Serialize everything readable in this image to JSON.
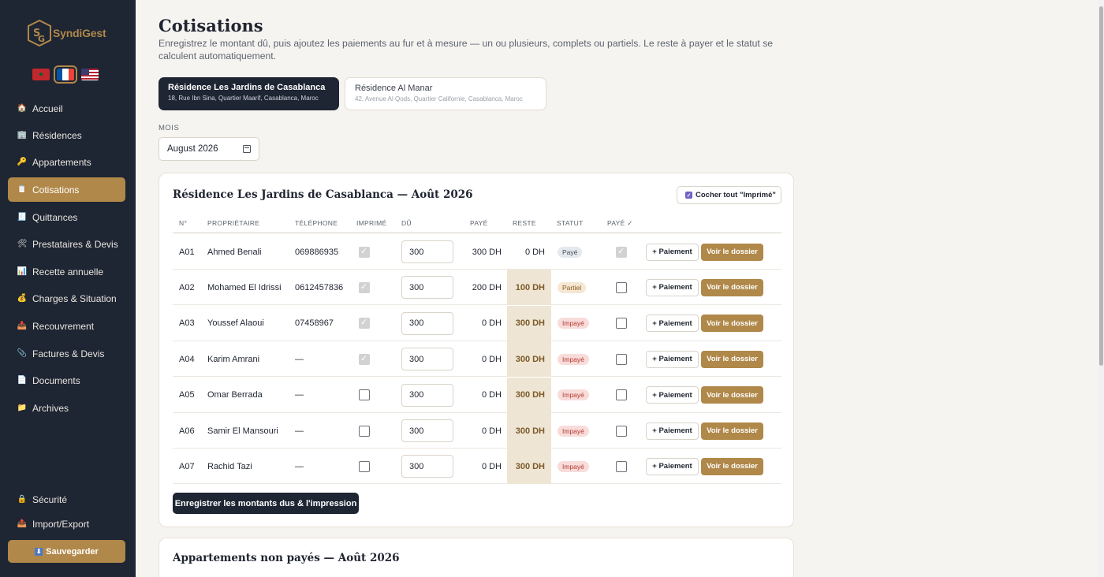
{
  "sidebar": {
    "brand": "SyndiGest",
    "languages": [
      {
        "code": "ar",
        "icon": "morocco-flag-icon"
      },
      {
        "code": "fr",
        "icon": "france-flag-icon",
        "active": true
      },
      {
        "code": "en",
        "icon": "usa-flag-icon"
      }
    ],
    "nav": [
      {
        "label": "Accueil",
        "icon": "home-icon"
      },
      {
        "label": "Résidences",
        "icon": "building-icon"
      },
      {
        "label": "Appartements",
        "icon": "key-icon"
      },
      {
        "label": "Cotisations",
        "icon": "clipboard-icon",
        "active": true
      },
      {
        "label": "Quittances",
        "icon": "receipt-icon"
      },
      {
        "label": "Prestataires & Devis",
        "icon": "tools-icon"
      },
      {
        "label": "Recette annuelle",
        "icon": "chart-icon"
      },
      {
        "label": "Charges & Situation",
        "icon": "money-bag-icon"
      },
      {
        "label": "Recouvrement",
        "icon": "inbox-icon"
      },
      {
        "label": "Factures & Devis",
        "icon": "paperclip-icon"
      },
      {
        "label": "Documents",
        "icon": "document-icon"
      },
      {
        "label": "Archives",
        "icon": "folder-icon"
      }
    ],
    "bottom_nav": [
      {
        "label": "Sécurité",
        "icon": "lock-icon"
      },
      {
        "label": "Import/Export",
        "icon": "import-export-icon"
      }
    ],
    "save_label": "Sauvegarder"
  },
  "header": {
    "title": "Cotisations",
    "description": "Enregistrez le montant dû, puis ajoutez les paiements au fur et à mesure — un ou plusieurs, complets ou partiels. Le reste à payer et le statut se calculent automatiquement."
  },
  "residences": [
    {
      "name": "Résidence Les Jardins de Casablanca",
      "address": "18, Rue Ibn Sina, Quartier Maarif, Casablanca, Maroc",
      "active": true
    },
    {
      "name": "Résidence Al Manar",
      "address": "42, Avenue Al Qods, Quartier Californie, Casablanca, Maroc",
      "active": false
    }
  ],
  "month": {
    "label": "MOIS",
    "value": "August 2026"
  },
  "table_panel": {
    "title": "Résidence Les Jardins de Casablanca — Août 2026",
    "check_all_label": "Cocher tout \"Imprimé\"",
    "columns": [
      "N°",
      "PROPRIÉTAIRE",
      "TÉLÉPHONE",
      "IMPRIMÉ",
      "DÛ",
      "PAYÉ",
      "RESTE",
      "STATUT",
      "PAYÉ ✓"
    ],
    "pay_button": "+ Paiement",
    "dossier_button": "Voir le dossier",
    "submit_label": "Enregistrer les montants dus & l'impression",
    "rows": [
      {
        "num": "A01",
        "owner": "Ahmed Benali",
        "phone": "069886935",
        "printed": true,
        "due": "300",
        "paid": "300 DH",
        "remaining": "0 DH",
        "status": "Payé",
        "status_kind": "paye",
        "paid_check": true
      },
      {
        "num": "A02",
        "owner": "Mohamed El Idrissi",
        "phone": "0612457836",
        "printed": true,
        "due": "300",
        "paid": "200 DH",
        "remaining": "100 DH",
        "status": "Partiel",
        "status_kind": "partiel",
        "paid_check": false
      },
      {
        "num": "A03",
        "owner": "Youssef Alaoui",
        "phone": "07458967",
        "printed": true,
        "due": "300",
        "paid": "0 DH",
        "remaining": "300 DH",
        "status": "Impayé",
        "status_kind": "impaye",
        "paid_check": false
      },
      {
        "num": "A04",
        "owner": "Karim Amrani",
        "phone": "—",
        "printed": true,
        "due": "300",
        "paid": "0 DH",
        "remaining": "300 DH",
        "status": "Impayé",
        "status_kind": "impaye",
        "paid_check": false
      },
      {
        "num": "A05",
        "owner": "Omar Berrada",
        "phone": "—",
        "printed": false,
        "due": "300",
        "paid": "0 DH",
        "remaining": "300 DH",
        "status": "Impayé",
        "status_kind": "impaye",
        "paid_check": false
      },
      {
        "num": "A06",
        "owner": "Samir El Mansouri",
        "phone": "—",
        "printed": false,
        "due": "300",
        "paid": "0 DH",
        "remaining": "300 DH",
        "status": "Impayé",
        "status_kind": "impaye",
        "paid_check": false
      },
      {
        "num": "A07",
        "owner": "Rachid Tazi",
        "phone": "—",
        "printed": false,
        "due": "300",
        "paid": "0 DH",
        "remaining": "300 DH",
        "status": "Impayé",
        "status_kind": "impaye",
        "paid_check": false
      }
    ]
  },
  "unpaid_panel": {
    "title": "Appartements non payés — Août 2026"
  },
  "colors": {
    "accent": "#b08849",
    "sidebar": "#1e2533",
    "owed_bg": "#efe5d4"
  }
}
